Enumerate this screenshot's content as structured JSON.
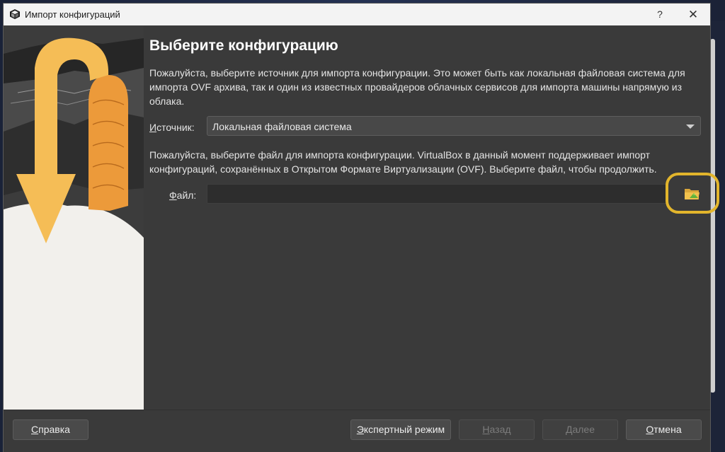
{
  "window": {
    "title": "Импорт конфигураций",
    "help_glyph": "?",
    "close_glyph": "✕"
  },
  "page": {
    "heading": "Выберите конфигурацию",
    "source_description": "Пожалуйста, выберите источник для импорта конфигурации. Это может быть как локальная файловая система для импорта OVF архива, так и один из известных провайдеров облачных сервисов для импорта машины напрямую из облака.",
    "source_label_accel": "И",
    "source_label_rest": "сточник:",
    "source_value": "Локальная файловая система",
    "file_description_line1": "Пожалуйста, выберите файл для импорта конфигурации. VirtualBox в данный момент поддерживает импорт",
    "file_description_line2": "конфигураций, сохранённых в Открытом Формате Виртуализации (OVF). Выберите файл, чтобы продолжить.",
    "file_label_accel": "Ф",
    "file_label_rest": "айл:",
    "file_value": "",
    "folder_icon": "folder-open-icon",
    "highlight_color": "#e2b52c"
  },
  "footer": {
    "help_accel": "С",
    "help_rest": "правка",
    "expert_accel": "Э",
    "expert_rest": "кспертный режим",
    "back_accel": "Н",
    "back_rest": "азад",
    "next_accel": "Д",
    "next_rest": "алее",
    "cancel_accel": "О",
    "cancel_rest": "тмена"
  }
}
